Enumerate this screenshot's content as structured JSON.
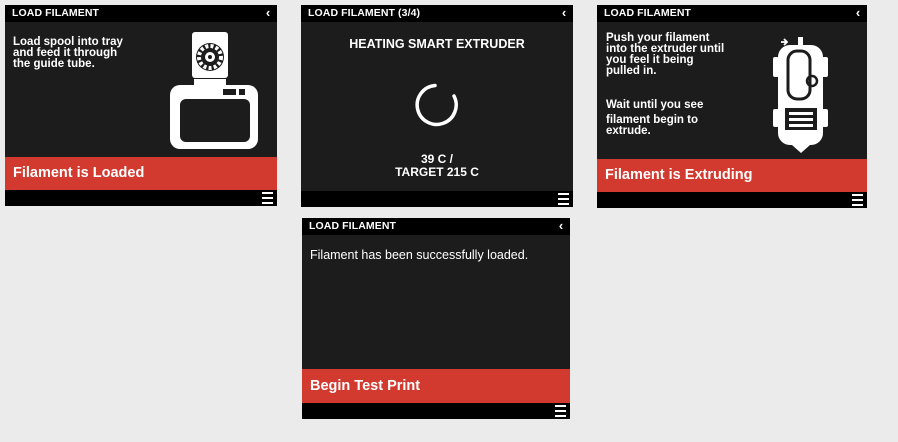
{
  "screens": {
    "s1": {
      "title": "LOAD FILAMENT",
      "instructions": [
        "Load spool into tray",
        "and feed it through",
        "the guide tube."
      ],
      "action_label": "Filament is Loaded",
      "illustration_icon": "spool-in-tray-icon"
    },
    "s2": {
      "title": "LOAD FILAMENT (3/4)",
      "heading": "HEATING SMART EXTRUDER",
      "current_temp": "39 C /",
      "target_temp": "TARGET 215 C",
      "spinner_icon": "loading-spinner-icon"
    },
    "s3": {
      "title": "LOAD FILAMENT",
      "instructions": [
        "Push your filament",
        "into the extruder until",
        "you feel it being",
        "pulled in."
      ],
      "instructions2": [
        "Wait until you see",
        "filament begin to",
        "extrude."
      ],
      "action_label": "Filament is Extruding",
      "illustration_icon": "smart-extruder-icon"
    },
    "s4": {
      "title": "LOAD FILAMENT",
      "message": "Filament has been successfully loaded.",
      "action_label": "Begin Test Print"
    }
  },
  "icons": {
    "back": "‹",
    "menu": "hamburger-menu-icon"
  },
  "colors": {
    "screen_bg": "#1c1c1c",
    "bar_bg": "#000000",
    "accent": "#d23a2f",
    "page_bg": "#ebebeb"
  }
}
